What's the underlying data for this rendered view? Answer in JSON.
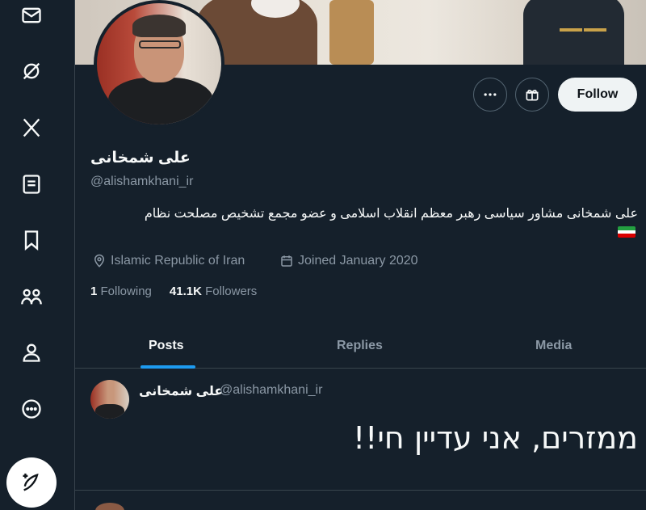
{
  "nav": {
    "items": [
      {
        "icon": "mail-icon"
      },
      {
        "icon": "grok-icon"
      },
      {
        "icon": "x-logo-icon"
      },
      {
        "icon": "lists-icon"
      },
      {
        "icon": "bookmark-icon"
      },
      {
        "icon": "communities-icon"
      },
      {
        "icon": "profile-icon"
      },
      {
        "icon": "more-icon"
      }
    ],
    "compose_icon": "compose-post-icon"
  },
  "profile": {
    "display_name": "علی شمخانی",
    "handle": "@alishamkhani_ir",
    "bio": "علی شمخانی مشاور سیاسی رهبر معظم انقلاب اسلامی و عضو مجمع تشخیص مصلحت نظام",
    "location": "Islamic Republic of Iran",
    "joined": "Joined January 2020",
    "following_count": "1",
    "following_label": "Following",
    "followers_count": "41.1K",
    "followers_label": "Followers",
    "follow_button": "Follow"
  },
  "tabs": [
    "Posts",
    "Replies",
    "Media"
  ],
  "active_tab": "Posts",
  "tweet": {
    "author_name": "علی شمخانی",
    "author_handle": "@alishamkhani_ir",
    "text": "ממזרים, אני עדיין חי!!"
  },
  "colors": {
    "background": "#15202b",
    "accent": "#1d9bf0",
    "muted_text": "#8b98a5",
    "border": "#38444d"
  }
}
